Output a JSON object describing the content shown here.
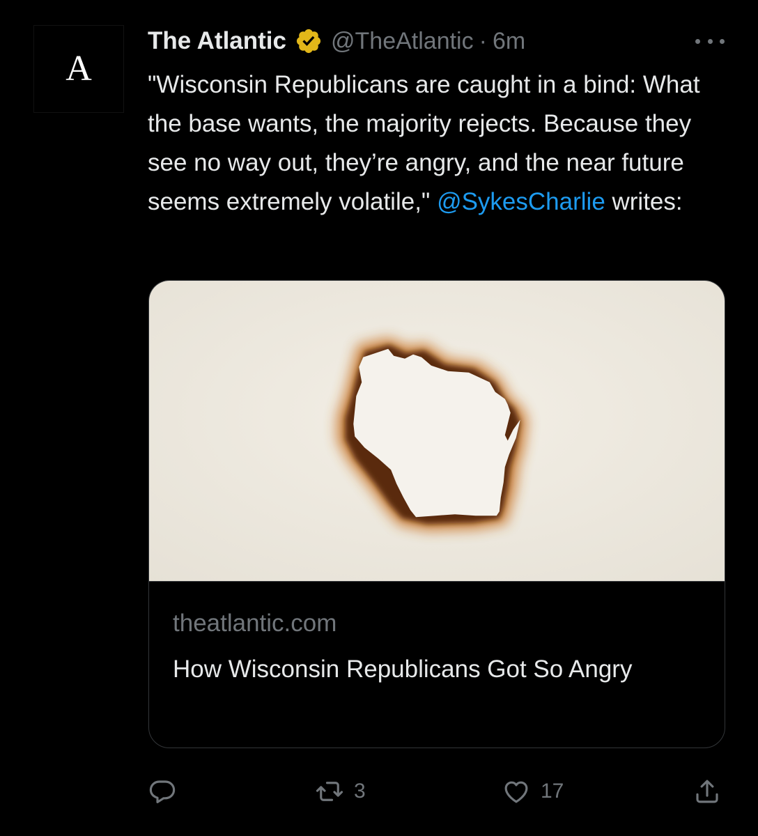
{
  "tweet": {
    "avatar_letter": "A",
    "display_name": "The Atlantic",
    "handle": "@TheAtlantic",
    "separator": "·",
    "time": "6m",
    "text_before_mention": "\"Wisconsin Republicans are caught in a bind: What the base wants, the majority rejects. Because they see no way out, they’re angry, and the near future seems extremely volatile,\" ",
    "mention": "@SykesCharlie",
    "text_after_mention": " writes:"
  },
  "card": {
    "domain": "theatlantic.com",
    "title": "How Wisconsin Republicans Got So Angry"
  },
  "actions": {
    "reply_count": "",
    "retweet_count": "3",
    "like_count": "17"
  },
  "colors": {
    "background": "#000000",
    "text": "#e7e9ea",
    "secondary": "#71767b",
    "link": "#1d9bf0",
    "verified_gold": "#e2b719",
    "card_paper": "#eeeae0"
  },
  "icons": {
    "verified": "verified-gold-badge-icon",
    "more": "more-horizontal-icon",
    "reply": "reply-icon",
    "retweet": "retweet-icon",
    "like": "heart-icon",
    "share": "share-icon"
  }
}
